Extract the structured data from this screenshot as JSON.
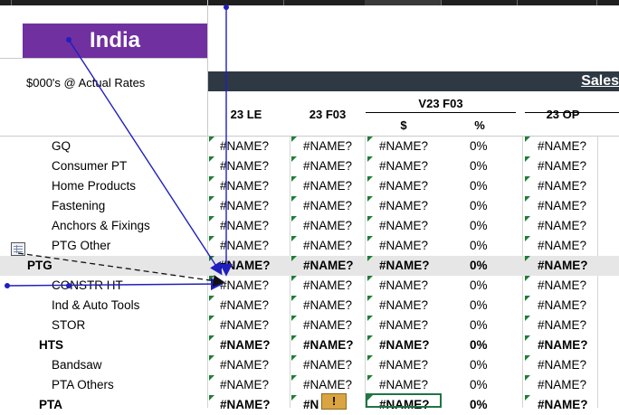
{
  "banner": {
    "title": "India"
  },
  "rates_label": "$000's @ Actual Rates",
  "sales_label": "Sales",
  "columns": {
    "le": "23 LE",
    "f03": "23 F03",
    "v23_group": "V23 F03",
    "v_dollar": "$",
    "v_pct": "%",
    "op": "23 OP"
  },
  "rows": [
    {
      "label": "GQ",
      "level": 1,
      "bold": false,
      "highlight": false,
      "le": "#NAME?",
      "f03": "#NAME?",
      "vd": "#NAME?",
      "vp": "0%",
      "op": "#NAME?"
    },
    {
      "label": "Consumer PT",
      "level": 1,
      "bold": false,
      "highlight": false,
      "le": "#NAME?",
      "f03": "#NAME?",
      "vd": "#NAME?",
      "vp": "0%",
      "op": "#NAME?"
    },
    {
      "label": "Home Products",
      "level": 1,
      "bold": false,
      "highlight": false,
      "le": "#NAME?",
      "f03": "#NAME?",
      "vd": "#NAME?",
      "vp": "0%",
      "op": "#NAME?"
    },
    {
      "label": "Fastening",
      "level": 1,
      "bold": false,
      "highlight": false,
      "le": "#NAME?",
      "f03": "#NAME?",
      "vd": "#NAME?",
      "vp": "0%",
      "op": "#NAME?"
    },
    {
      "label": "Anchors & Fixings",
      "level": 1,
      "bold": false,
      "highlight": false,
      "le": "#NAME?",
      "f03": "#NAME?",
      "vd": "#NAME?",
      "vp": "0%",
      "op": "#NAME?"
    },
    {
      "label": "PTG Other",
      "level": 1,
      "bold": false,
      "highlight": false,
      "le": "#NAME?",
      "f03": "#NAME?",
      "vd": "#NAME?",
      "vp": "0%",
      "op": "#NAME?"
    },
    {
      "label": "PTG",
      "level": 0,
      "bold": true,
      "highlight": true,
      "le": "#NAME?",
      "f03": "#NAME?",
      "vd": "#NAME?",
      "vp": "0%",
      "op": "#NAME?"
    },
    {
      "label": "CONSTR HT",
      "level": 1,
      "bold": false,
      "highlight": false,
      "le": "#NAME?",
      "f03": "#NAME?",
      "vd": "#NAME?",
      "vp": "0%",
      "op": "#NAME?"
    },
    {
      "label": "Ind & Auto Tools",
      "level": 1,
      "bold": false,
      "highlight": false,
      "le": "#NAME?",
      "f03": "#NAME?",
      "vd": "#NAME?",
      "vp": "0%",
      "op": "#NAME?"
    },
    {
      "label": "STOR",
      "level": 1,
      "bold": false,
      "highlight": false,
      "le": "#NAME?",
      "f03": "#NAME?",
      "vd": "#NAME?",
      "vp": "0%",
      "op": "#NAME?"
    },
    {
      "label": "HTS",
      "level": 2,
      "bold": true,
      "highlight": false,
      "le": "#NAME?",
      "f03": "#NAME?",
      "vd": "#NAME?",
      "vp": "0%",
      "op": "#NAME?"
    },
    {
      "label": "Bandsaw",
      "level": 1,
      "bold": false,
      "highlight": false,
      "le": "#NAME?",
      "f03": "#NAME?",
      "vd": "#NAME?",
      "vp": "0%",
      "op": "#NAME?"
    },
    {
      "label": "PTA Others",
      "level": 1,
      "bold": false,
      "highlight": false,
      "le": "#NAME?",
      "f03": "#NAME?",
      "vd": "#NAME?",
      "vp": "0%",
      "op": "#NAME?"
    },
    {
      "label": "PTA",
      "level": 2,
      "bold": true,
      "highlight": false,
      "le": "#NAME?",
      "f03": "#N",
      "vd": "#NAME?",
      "vp": "0%",
      "op": "#NAME?"
    }
  ],
  "warning_glyph": "!",
  "colors": {
    "banner": "#7030a0",
    "sales_bar": "#2f3943",
    "error_marker": "#1e7e34",
    "tracer_arrow": "#1f1fbf"
  }
}
